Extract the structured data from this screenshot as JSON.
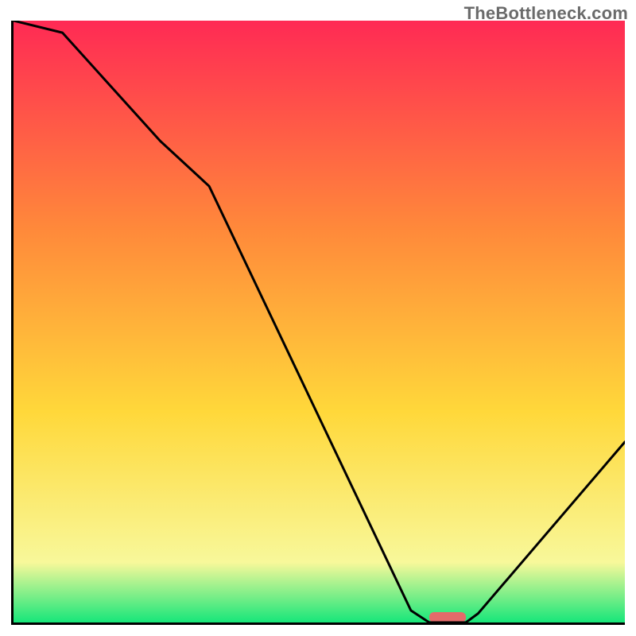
{
  "watermark": "TheBottleneck.com",
  "chart_data": {
    "type": "line",
    "title": "",
    "xlabel": "",
    "ylabel": "",
    "xlim": [
      0,
      100
    ],
    "ylim": [
      0,
      100
    ],
    "series": [
      {
        "name": "bottleneck-curve",
        "x": [
          0,
          8,
          24,
          32,
          65,
          68,
          74,
          76,
          100
        ],
        "values": [
          100,
          98,
          80,
          72.5,
          2,
          0,
          0,
          1.5,
          30
        ],
        "color": "#000000"
      }
    ],
    "marker": {
      "name": "optimal-zone",
      "x_range": [
        68,
        74
      ],
      "y": 0,
      "color": "#e46a6a"
    },
    "background_gradient": {
      "top": "#ff2a54",
      "upper": "#ff8a3a",
      "mid": "#ffd83a",
      "lower": "#f8f89a",
      "bottom": "#17e67a"
    },
    "grid": false,
    "legend": false
  }
}
